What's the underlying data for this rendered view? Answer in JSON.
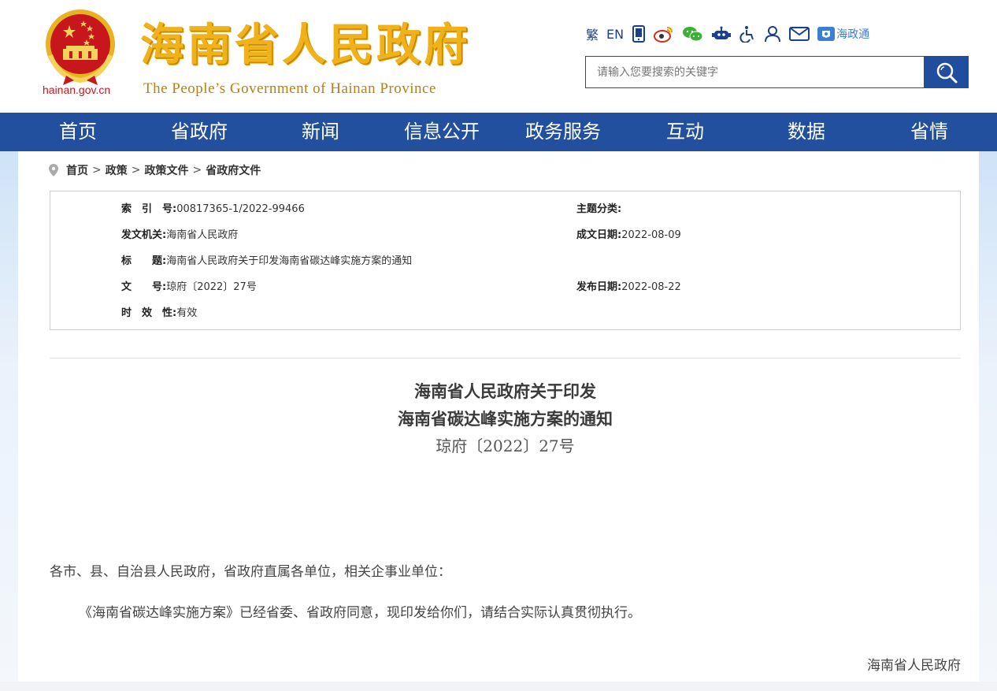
{
  "header": {
    "domain": "hainan.gov.cn",
    "title": "海南省人民政府",
    "subtitle": "The People’s Government  of Hainan Province",
    "toolbar": {
      "traditional": "繁",
      "english": "EN",
      "icons": [
        "mobile-icon",
        "weibo-icon",
        "wechat-icon",
        "robot-icon",
        "accessibility-icon",
        "user-icon",
        "mail-icon"
      ],
      "app_label": "海政通"
    },
    "search": {
      "placeholder": "请输入您要搜索的关键字"
    }
  },
  "nav": {
    "items": [
      "首页",
      "省政府",
      "新闻",
      "信息公开",
      "政务服务",
      "互动",
      "数据",
      "省情"
    ]
  },
  "breadcrumb": {
    "items": [
      "首页",
      "政策",
      "政策文件",
      "省政府文件"
    ],
    "separator": ">"
  },
  "meta": {
    "index_label": "索　引　号:",
    "index_value": "00817365-1/2022-99466",
    "topic_label": "主题分类:",
    "topic_value": "",
    "issuer_label": "发文机关:",
    "issuer_value": "海南省人民政府",
    "created_label": "成文日期:",
    "created_value": "2022-08-09",
    "title_label": "标　　题:",
    "title_value": "海南省人民政府关于印发海南省碳达峰实施方案的通知",
    "docno_label": "文　　号:",
    "docno_value": "琼府〔2022〕27号",
    "published_label": "发布日期:",
    "published_value": "2022-08-22",
    "validity_label": "时　效　性:",
    "validity_value": "有效"
  },
  "article": {
    "title_line1": "海南省人民政府关于印发",
    "title_line2": "海南省碳达峰实施方案的通知",
    "doc_number": "琼府〔2022〕27号",
    "salutation": "各市、县、自治县人民政府，省政府直属各单位，相关企事业单位：",
    "body": "《海南省碳达峰实施方案》已经省委、省政府同意，现印发给你们，请结合实际认真贯彻执行。",
    "signature": "海南省人民政府"
  },
  "colors": {
    "nav_bg": "#224f9e",
    "title_gold": "#f0b21b",
    "emblem_red": "#c8161d"
  }
}
